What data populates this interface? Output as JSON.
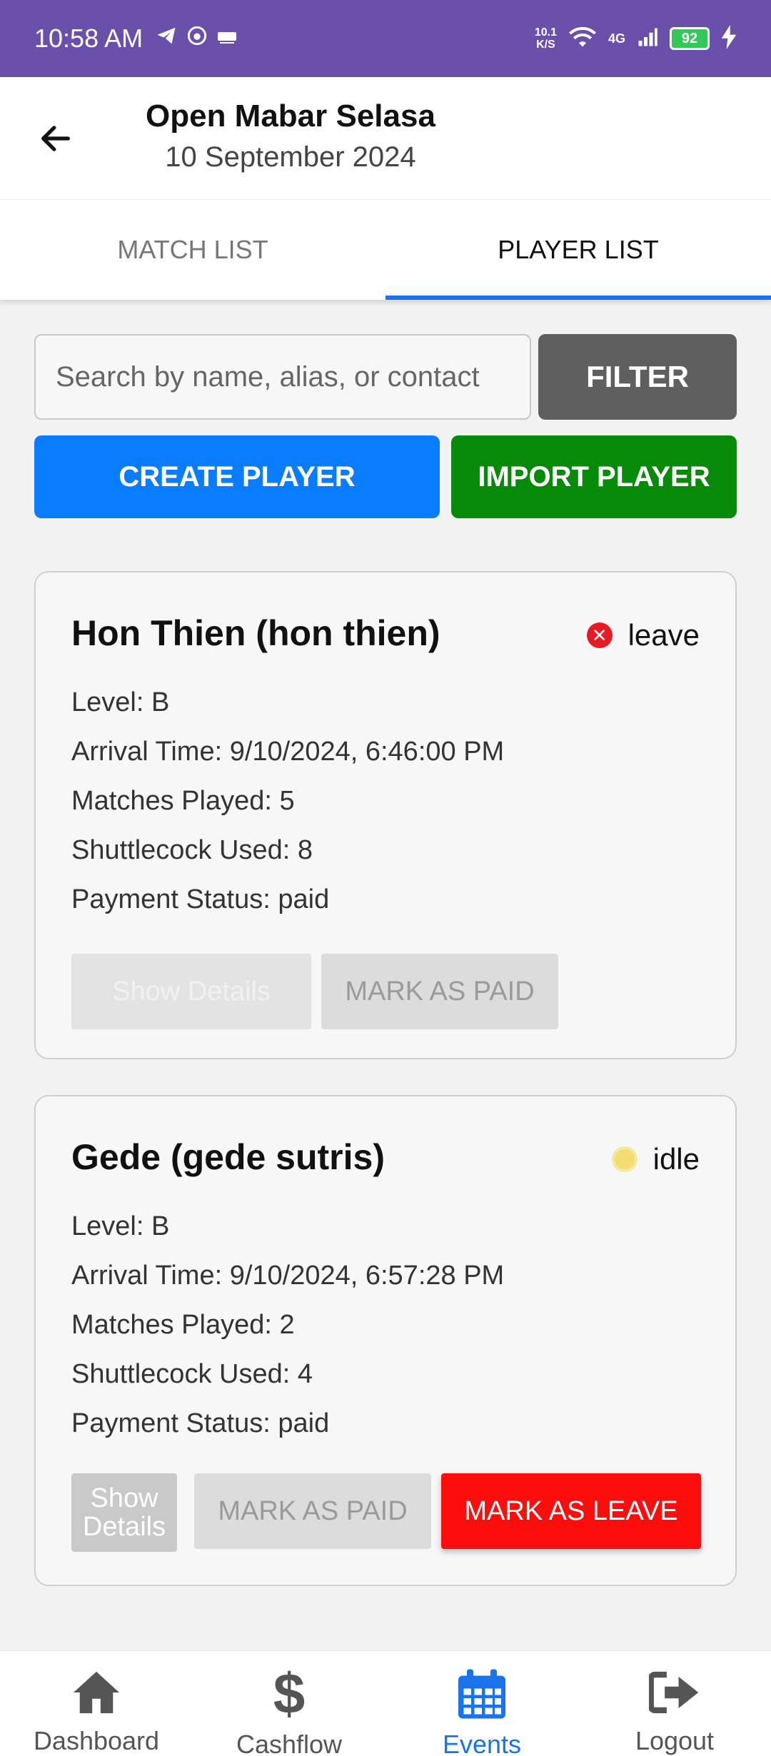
{
  "status_bar": {
    "time": "10:58 AM",
    "netspeed_value": "10.1",
    "netspeed_unit": "K/S",
    "network": "4G",
    "battery": "92"
  },
  "header": {
    "title": "Open Mabar Selasa",
    "date": "10 September 2024"
  },
  "tabs": [
    {
      "label": "MATCH LIST"
    },
    {
      "label": "PLAYER LIST"
    }
  ],
  "search": {
    "placeholder": "Search by name, alias, or contact",
    "value": ""
  },
  "buttons": {
    "filter": "FILTER",
    "create_player": "CREATE PLAYER",
    "import_player": "IMPORT PLAYER"
  },
  "players": [
    {
      "name": "Hon Thien (hon thien)",
      "status": "leave",
      "level": "Level: B",
      "arrival": "Arrival Time: 9/10/2024, 6:46:00 PM",
      "matches": "Matches Played: 5",
      "shuttlecock": "Shuttlecock Used: 8",
      "payment": "Payment Status: paid",
      "show_details": "Show Details",
      "mark_paid": "MARK AS PAID"
    },
    {
      "name": "Gede (gede sutris)",
      "status": "idle",
      "level": "Level: B",
      "arrival": "Arrival Time: 9/10/2024, 6:57:28 PM",
      "matches": "Matches Played: 2",
      "shuttlecock": "Shuttlecock Used: 4",
      "payment": "Payment Status: paid",
      "show_details_line1": "Show",
      "show_details_line2": "Details",
      "mark_paid": "MARK AS PAID",
      "mark_leave": "MARK AS LEAVE"
    }
  ],
  "nav": [
    {
      "label": "Dashboard",
      "icon": "home-icon"
    },
    {
      "label": "Cashflow",
      "icon": "dollar-icon"
    },
    {
      "label": "Events",
      "icon": "calendar-icon"
    },
    {
      "label": "Logout",
      "icon": "logout-icon"
    }
  ],
  "colors": {
    "status_bar": "#6a4fab",
    "tab_indicator": "#1a73e8",
    "create_button": "#0a7cff",
    "import_button": "#078a07",
    "filter_button": "#5f5f5f",
    "leave_button": "#ff0d0d",
    "leave_status": "#e51c23",
    "idle_status": "#f3dc72"
  }
}
